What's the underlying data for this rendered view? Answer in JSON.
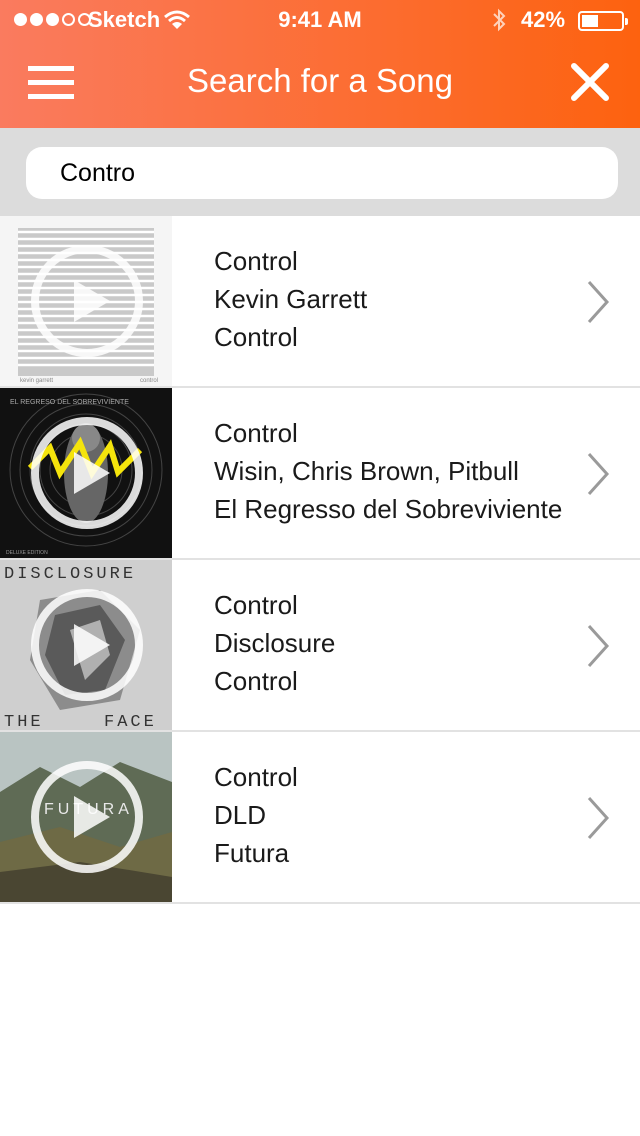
{
  "status_bar": {
    "carrier": "Sketch",
    "time": "9:41 AM",
    "battery": "42%",
    "battery_level": 0.42
  },
  "header": {
    "title": "Search for a Song"
  },
  "search": {
    "value": "Contro",
    "placeholder": ""
  },
  "results": [
    {
      "song": "Control",
      "artist": "Kevin Garrett",
      "album": "Control",
      "cover_texts": [
        "kevin garrett",
        "control"
      ]
    },
    {
      "song": "Control",
      "artist": "Wisin, Chris Brown, Pitbull",
      "album": "El Regresso del Sobreviviente",
      "cover_texts": [
        "EL REGRESO DEL SOBREVIVIENTE",
        "DELUXE EDITION"
      ]
    },
    {
      "song": "Control",
      "artist": "Disclosure",
      "album": "Control",
      "cover_texts": [
        "DISCLOSURE",
        "THE",
        "FACE"
      ]
    },
    {
      "song": "Control",
      "artist": "DLD",
      "album": "Futura",
      "cover_texts": [
        "FUTURA"
      ]
    }
  ],
  "colors": {
    "header_start": "#fa7b5f",
    "header_end": "#fd620f",
    "search_bg": "#dcdcdc"
  },
  "icons": [
    "menu-icon",
    "close-icon",
    "wifi-icon",
    "bluetooth-icon",
    "battery-icon",
    "play-icon",
    "chevron-right-icon"
  ]
}
